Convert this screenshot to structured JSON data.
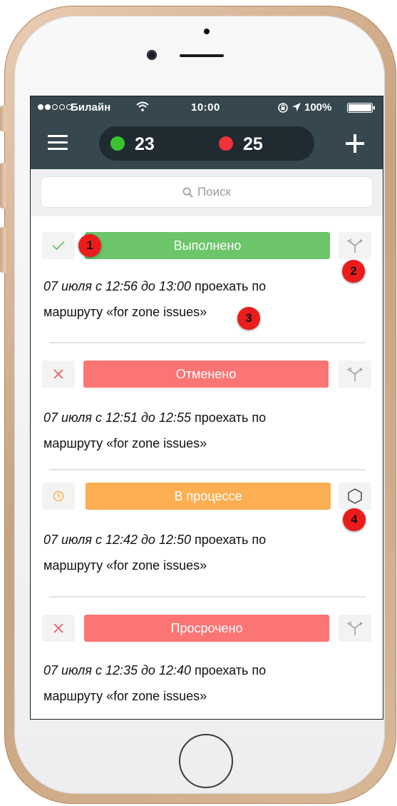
{
  "status_bar": {
    "carrier": "Билайн",
    "time": "10:00",
    "battery": "100%"
  },
  "header": {
    "green_count": "23",
    "red_count": "25",
    "colors": {
      "header_bg": "#37474f",
      "green": "#39c42f",
      "red": "#f0323b"
    }
  },
  "search": {
    "placeholder": "Поиск"
  },
  "tasks": [
    {
      "status_label": "Выполнено",
      "status_color": "#6cc46b",
      "status_icon": "check-icon",
      "route_icon": "route-icon",
      "time_text": "07 июля с 12:56 до 13:00",
      "action_text": " проехать по",
      "route_text": "маршруту «for zone issues»"
    },
    {
      "status_label": "Отменено",
      "status_color": "#fb7575",
      "status_icon": "cross-icon",
      "route_icon": "route-icon",
      "time_text": "07 июля с 12:51 до 12:55",
      "action_text": " проехать по",
      "route_text": "маршруту «for zone issues»"
    },
    {
      "status_label": "В процессе",
      "status_color": "#fbae52",
      "status_icon": "clock-icon",
      "route_icon": "hexagon-icon",
      "time_text": "07 июля с 12:42 до 12:50",
      "action_text": " проехать по",
      "route_text": "маршруту «for zone issues»"
    },
    {
      "status_label": "Просрочено",
      "status_color": "#fb7575",
      "status_icon": "cross-icon",
      "route_icon": "route-icon",
      "time_text": "07 июля с 12:35 до 12:40",
      "action_text": " проехать по",
      "route_text": "маршруту «for zone issues»"
    }
  ],
  "markers": [
    "1",
    "2",
    "3",
    "4"
  ]
}
